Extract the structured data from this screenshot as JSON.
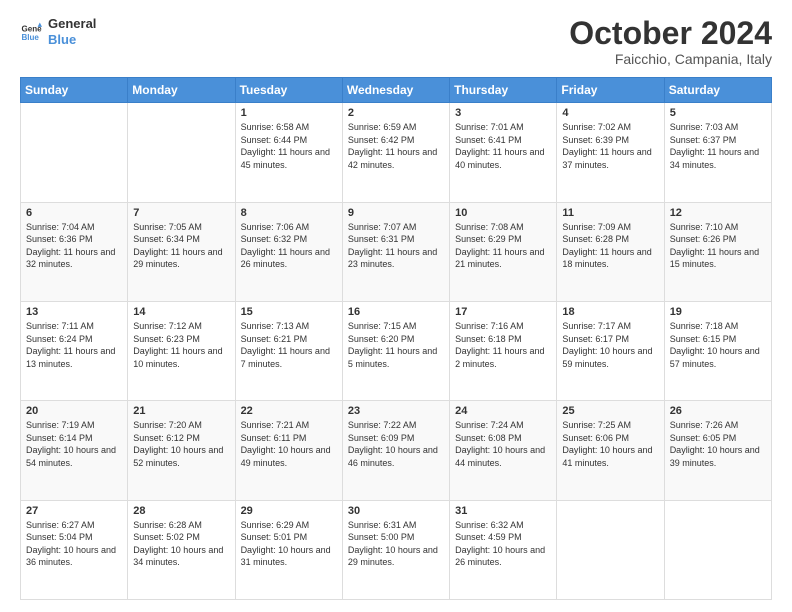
{
  "header": {
    "logo_line1": "General",
    "logo_line2": "Blue",
    "title": "October 2024",
    "location": "Faicchio, Campania, Italy"
  },
  "weekdays": [
    "Sunday",
    "Monday",
    "Tuesday",
    "Wednesday",
    "Thursday",
    "Friday",
    "Saturday"
  ],
  "weeks": [
    [
      {
        "day": "",
        "info": ""
      },
      {
        "day": "",
        "info": ""
      },
      {
        "day": "1",
        "info": "Sunrise: 6:58 AM\nSunset: 6:44 PM\nDaylight: 11 hours and 45 minutes."
      },
      {
        "day": "2",
        "info": "Sunrise: 6:59 AM\nSunset: 6:42 PM\nDaylight: 11 hours and 42 minutes."
      },
      {
        "day": "3",
        "info": "Sunrise: 7:01 AM\nSunset: 6:41 PM\nDaylight: 11 hours and 40 minutes."
      },
      {
        "day": "4",
        "info": "Sunrise: 7:02 AM\nSunset: 6:39 PM\nDaylight: 11 hours and 37 minutes."
      },
      {
        "day": "5",
        "info": "Sunrise: 7:03 AM\nSunset: 6:37 PM\nDaylight: 11 hours and 34 minutes."
      }
    ],
    [
      {
        "day": "6",
        "info": "Sunrise: 7:04 AM\nSunset: 6:36 PM\nDaylight: 11 hours and 32 minutes."
      },
      {
        "day": "7",
        "info": "Sunrise: 7:05 AM\nSunset: 6:34 PM\nDaylight: 11 hours and 29 minutes."
      },
      {
        "day": "8",
        "info": "Sunrise: 7:06 AM\nSunset: 6:32 PM\nDaylight: 11 hours and 26 minutes."
      },
      {
        "day": "9",
        "info": "Sunrise: 7:07 AM\nSunset: 6:31 PM\nDaylight: 11 hours and 23 minutes."
      },
      {
        "day": "10",
        "info": "Sunrise: 7:08 AM\nSunset: 6:29 PM\nDaylight: 11 hours and 21 minutes."
      },
      {
        "day": "11",
        "info": "Sunrise: 7:09 AM\nSunset: 6:28 PM\nDaylight: 11 hours and 18 minutes."
      },
      {
        "day": "12",
        "info": "Sunrise: 7:10 AM\nSunset: 6:26 PM\nDaylight: 11 hours and 15 minutes."
      }
    ],
    [
      {
        "day": "13",
        "info": "Sunrise: 7:11 AM\nSunset: 6:24 PM\nDaylight: 11 hours and 13 minutes."
      },
      {
        "day": "14",
        "info": "Sunrise: 7:12 AM\nSunset: 6:23 PM\nDaylight: 11 hours and 10 minutes."
      },
      {
        "day": "15",
        "info": "Sunrise: 7:13 AM\nSunset: 6:21 PM\nDaylight: 11 hours and 7 minutes."
      },
      {
        "day": "16",
        "info": "Sunrise: 7:15 AM\nSunset: 6:20 PM\nDaylight: 11 hours and 5 minutes."
      },
      {
        "day": "17",
        "info": "Sunrise: 7:16 AM\nSunset: 6:18 PM\nDaylight: 11 hours and 2 minutes."
      },
      {
        "day": "18",
        "info": "Sunrise: 7:17 AM\nSunset: 6:17 PM\nDaylight: 10 hours and 59 minutes."
      },
      {
        "day": "19",
        "info": "Sunrise: 7:18 AM\nSunset: 6:15 PM\nDaylight: 10 hours and 57 minutes."
      }
    ],
    [
      {
        "day": "20",
        "info": "Sunrise: 7:19 AM\nSunset: 6:14 PM\nDaylight: 10 hours and 54 minutes."
      },
      {
        "day": "21",
        "info": "Sunrise: 7:20 AM\nSunset: 6:12 PM\nDaylight: 10 hours and 52 minutes."
      },
      {
        "day": "22",
        "info": "Sunrise: 7:21 AM\nSunset: 6:11 PM\nDaylight: 10 hours and 49 minutes."
      },
      {
        "day": "23",
        "info": "Sunrise: 7:22 AM\nSunset: 6:09 PM\nDaylight: 10 hours and 46 minutes."
      },
      {
        "day": "24",
        "info": "Sunrise: 7:24 AM\nSunset: 6:08 PM\nDaylight: 10 hours and 44 minutes."
      },
      {
        "day": "25",
        "info": "Sunrise: 7:25 AM\nSunset: 6:06 PM\nDaylight: 10 hours and 41 minutes."
      },
      {
        "day": "26",
        "info": "Sunrise: 7:26 AM\nSunset: 6:05 PM\nDaylight: 10 hours and 39 minutes."
      }
    ],
    [
      {
        "day": "27",
        "info": "Sunrise: 6:27 AM\nSunset: 5:04 PM\nDaylight: 10 hours and 36 minutes."
      },
      {
        "day": "28",
        "info": "Sunrise: 6:28 AM\nSunset: 5:02 PM\nDaylight: 10 hours and 34 minutes."
      },
      {
        "day": "29",
        "info": "Sunrise: 6:29 AM\nSunset: 5:01 PM\nDaylight: 10 hours and 31 minutes."
      },
      {
        "day": "30",
        "info": "Sunrise: 6:31 AM\nSunset: 5:00 PM\nDaylight: 10 hours and 29 minutes."
      },
      {
        "day": "31",
        "info": "Sunrise: 6:32 AM\nSunset: 4:59 PM\nDaylight: 10 hours and 26 minutes."
      },
      {
        "day": "",
        "info": ""
      },
      {
        "day": "",
        "info": ""
      }
    ]
  ]
}
